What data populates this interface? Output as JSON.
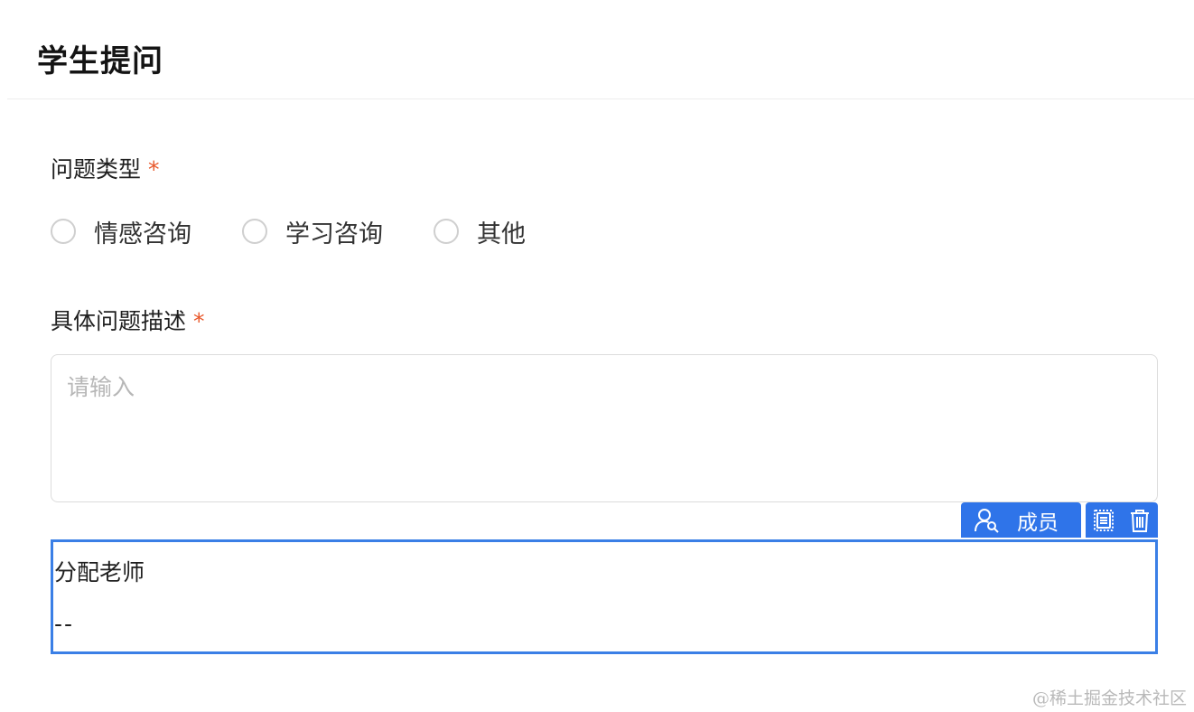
{
  "page": {
    "title": "学生提问"
  },
  "question_type": {
    "label": "问题类型",
    "required_mark": "*",
    "options": [
      {
        "label": "情感咨询"
      },
      {
        "label": "学习咨询"
      },
      {
        "label": "其他"
      }
    ]
  },
  "description": {
    "label": "具体问题描述",
    "required_mark": "*",
    "placeholder": "请输入",
    "value": ""
  },
  "toolbar": {
    "member_label": "成员",
    "member_icon": "user-search-icon",
    "copy_icon": "copy-icon",
    "delete_icon": "trash-icon",
    "accent_color": "#2f74e9"
  },
  "assign_teacher": {
    "label": "分配老师",
    "value": "--"
  },
  "watermark": {
    "text": "@稀土掘金技术社区"
  },
  "colors": {
    "required": "#e8572a",
    "selection_border": "#3a7fe6"
  }
}
